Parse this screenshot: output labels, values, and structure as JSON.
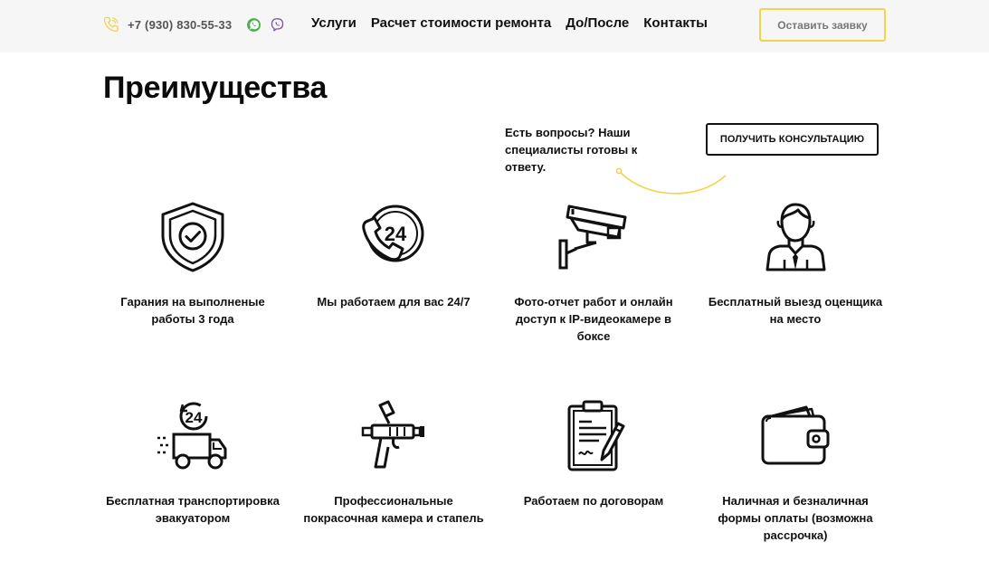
{
  "header": {
    "phone": "+7 (930) 830-55-33",
    "icons": {
      "phone": "phone-icon",
      "whatsapp": "whatsapp-icon",
      "viber": "viber-icon"
    },
    "nav": [
      {
        "label": "Услуги"
      },
      {
        "label": "Расчет стоимости ремонта"
      },
      {
        "label": "До/После"
      },
      {
        "label": "Контакты"
      }
    ],
    "cta_label": "Оставить заявку"
  },
  "section": {
    "title": "Преимущества",
    "question": "Есть вопросы? Наши специалисты готовы к ответу.",
    "consult_label": "ПОЛУЧИТЬ КОНСУЛЬТАЦИЮ"
  },
  "features": [
    {
      "label": "Гарания на выполненые работы 3 года",
      "icon": "shield-check-icon"
    },
    {
      "label": "Мы работаем для вас 24/7",
      "icon": "phone-24-icon"
    },
    {
      "label": "Фото-отчет работ и онлайн доступ к IP-видеокамере в боксе",
      "icon": "security-camera-icon"
    },
    {
      "label": "Бесплатный выезд оценщика на место",
      "icon": "manager-icon"
    },
    {
      "label": "Бесплатная транспортировка эвакуатором",
      "icon": "delivery-truck-24-icon"
    },
    {
      "label": "Профессиональные покрасочная камера и стапель",
      "icon": "spray-gun-icon"
    },
    {
      "label": "Работаем по договорам",
      "icon": "contract-clipboard-icon"
    },
    {
      "label": "Наличная и безналичная формы оплаты (возможна рассрочка)",
      "icon": "wallet-icon"
    }
  ],
  "colors": {
    "accent": "#f3d34a",
    "whatsapp": "#4caf50",
    "viber": "#7b519d",
    "text": "#111111"
  }
}
